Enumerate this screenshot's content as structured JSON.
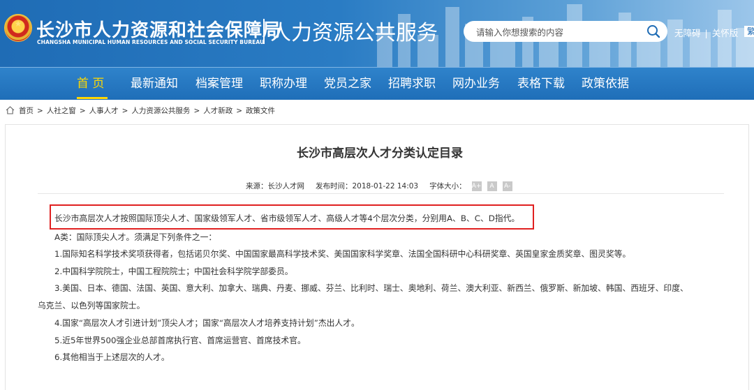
{
  "header": {
    "bureau_cn": "长沙市人力资源和社会保障局",
    "bureau_en": "CHANGSHA MUNICIPAL HUMAN RESOURCES AND SOCIAL SECURITY BUREAU",
    "portal_name": "人力资源公共服务",
    "search_placeholder": "请输入你想搜索的内容",
    "links": {
      "accessible": "无障碍",
      "elderly": "关怀版",
      "edge_partial": "繁"
    }
  },
  "nav": [
    "首 页",
    "最新通知",
    "档案管理",
    "职称办理",
    "党员之家",
    "招聘求职",
    "网办业务",
    "表格下载",
    "政策依据"
  ],
  "breadcrumb": [
    "首页",
    "人社之窗",
    "人事人才",
    "人力资源公共服务",
    "人才新政",
    "政策文件"
  ],
  "article": {
    "title": "长沙市高层次人才分类认定目录",
    "source": "来源：长沙人才网",
    "published": "发布时间：2018-01-22 14:03",
    "font_size_label": "字体大小：",
    "font_buttons": [
      "A+",
      "A",
      "A-"
    ],
    "paragraphs": [
      "长沙市高层次人才按照国际顶尖人才、国家级领军人才、省市级领军人才、高级人才等4个层次分类，分别用A、B、C、D指代。",
      "A类：国际顶尖人才。须满足下列条件之一：",
      "1.国际知名科学技术奖项获得者，包括诺贝尔奖、中国国家最高科学技术奖、美国国家科学奖章、法国全国科研中心科研奖章、英国皇家金质奖章、图灵奖等。",
      "2.中国科学院院士，中国工程院院士；中国社会科学院学部委员。",
      "3.美国、日本、德国、法国、英国、意大利、加拿大、瑞典、丹麦、挪威、芬兰、比利时、瑞士、奥地利、荷兰、澳大利亚、新西兰、俄罗斯、新加坡、韩国、西班牙、印度、",
      "乌克兰、以色列等国家院士。",
      "4.国家“高层次人才引进计划”顶尖人才；国家“高层次人才培养支持计划”杰出人才。",
      "5.近5年世界500强企业总部首席执行官、首席运营官、首席技术官。",
      "6.其他相当于上述层次的人才。"
    ]
  },
  "colors": {
    "header_blue": "#1f6cb5",
    "nav_active": "#ffd800",
    "highlight_red": "#e02020"
  }
}
